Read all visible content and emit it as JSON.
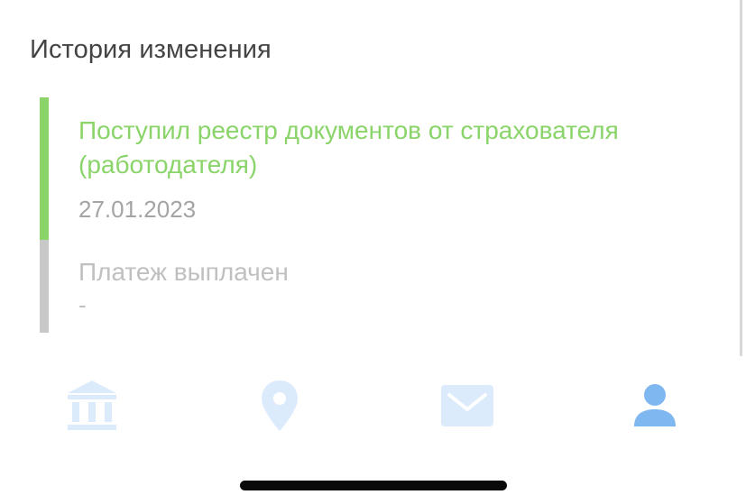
{
  "history": {
    "title": "История изменения",
    "events": [
      {
        "status": "active",
        "title": "Поступил реестр документов от страхователя (работодателя)",
        "date": "27.01.2023"
      },
      {
        "status": "pending",
        "title": "Платеж выплачен",
        "date": "-"
      }
    ]
  },
  "colors": {
    "active_accent": "#8ad46a",
    "pending_accent": "#c8c8c8",
    "tab_inactive": "#dcebfb",
    "tab_active": "#7fb7f0"
  },
  "tabbar": {
    "items": [
      {
        "icon": "bank-icon",
        "active": false
      },
      {
        "icon": "location-pin-icon",
        "active": false
      },
      {
        "icon": "mail-icon",
        "active": false
      },
      {
        "icon": "profile-icon",
        "active": true
      }
    ]
  }
}
